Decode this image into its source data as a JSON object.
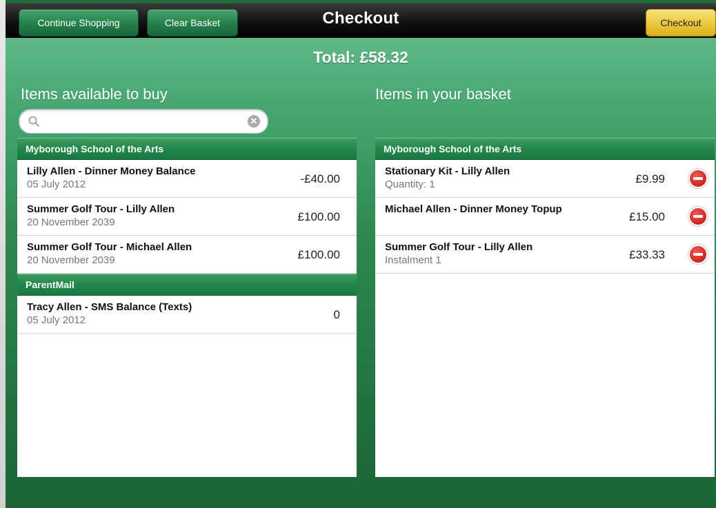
{
  "toolbar": {
    "continue_label": "Continue Shopping",
    "clear_label": "Clear Basket",
    "title": "Checkout",
    "checkout_label": "Checkout"
  },
  "total": "Total: £58.32",
  "available": {
    "heading": "Items available to buy",
    "search": {
      "value": "",
      "placeholder": ""
    },
    "sections": [
      {
        "name": "Myborough School of the Arts",
        "items": [
          {
            "title": "Lilly Allen - Dinner Money Balance",
            "sub": "05 July 2012",
            "price": "-£40.00"
          },
          {
            "title": "Summer Golf Tour - Lilly Allen",
            "sub": "20 November 2039",
            "price": "£100.00"
          },
          {
            "title": "Summer Golf Tour - Michael Allen",
            "sub": "20 November 2039",
            "price": "£100.00"
          }
        ]
      },
      {
        "name": "ParentMail",
        "items": [
          {
            "title": "Tracy Allen - SMS Balance (Texts)",
            "sub": "05 July 2012",
            "price": "0"
          }
        ]
      }
    ]
  },
  "basket": {
    "heading": "Items in your basket",
    "sections": [
      {
        "name": "Myborough School of the Arts",
        "items": [
          {
            "title": "Stationary Kit - Lilly Allen",
            "sub": "Quantity: 1",
            "price": "£9.99"
          },
          {
            "title": "Michael Allen - Dinner Money Topup",
            "sub": "",
            "price": "£15.00"
          },
          {
            "title": "Summer Golf Tour - Lilly Allen",
            "sub": "Instalment 1",
            "price": "£33.33"
          }
        ]
      }
    ]
  },
  "colors": {
    "accent_green": "#23804a",
    "checkout_yellow": "#eac83c",
    "remove_red": "#d42a24"
  }
}
